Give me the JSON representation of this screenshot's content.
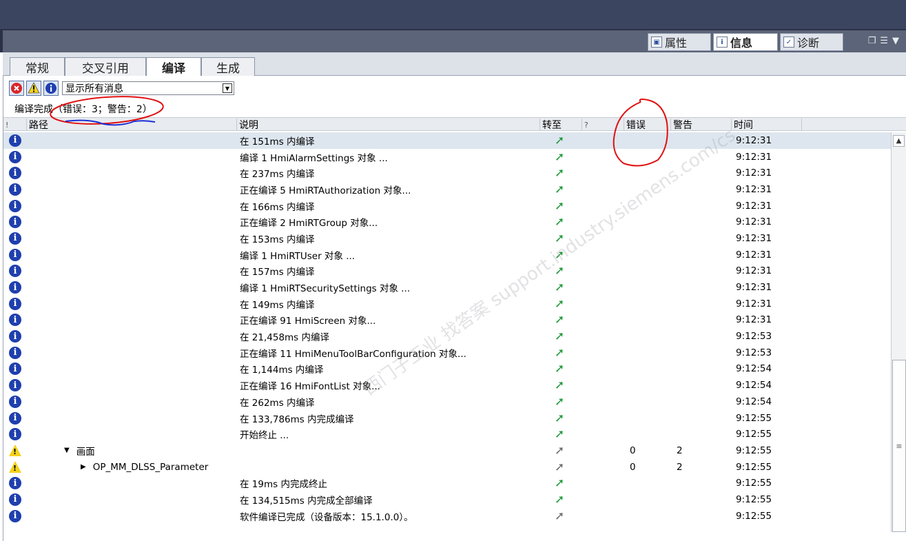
{
  "right_tabs": [
    {
      "label": "属性",
      "icon": "properties-icon"
    },
    {
      "label": "信息",
      "icon": "info-icon"
    },
    {
      "label": "诊断",
      "icon": "diagnostics-icon"
    }
  ],
  "left_tabs": [
    "常规",
    "交叉引用",
    "编译",
    "生成"
  ],
  "filter": {
    "selected": "显示所有消息"
  },
  "status_text": "编译完成（错误：3；警告：2）",
  "headers": {
    "bang": "!",
    "path": "路径",
    "desc": "说明",
    "goto": "转至",
    "q": "?",
    "errors": "错误",
    "warnings": "警告",
    "time": "时间"
  },
  "rows": [
    {
      "type": "info",
      "path": "",
      "desc": "在 151ms 内编译",
      "errors": "",
      "warnings": "",
      "time": "9:12:31",
      "goto": "green"
    },
    {
      "type": "info",
      "path": "",
      "desc": "编译 1 HmiAlarmSettings 对象 ...",
      "errors": "",
      "warnings": "",
      "time": "9:12:31",
      "goto": "green"
    },
    {
      "type": "info",
      "path": "",
      "desc": "在 237ms 内编译",
      "errors": "",
      "warnings": "",
      "time": "9:12:31",
      "goto": "green"
    },
    {
      "type": "info",
      "path": "",
      "desc": "正在编译 5 HmiRTAuthorization 对象...",
      "errors": "",
      "warnings": "",
      "time": "9:12:31",
      "goto": "green"
    },
    {
      "type": "info",
      "path": "",
      "desc": "在 166ms 内编译",
      "errors": "",
      "warnings": "",
      "time": "9:12:31",
      "goto": "green"
    },
    {
      "type": "info",
      "path": "",
      "desc": "正在编译 2 HmiRTGroup 对象...",
      "errors": "",
      "warnings": "",
      "time": "9:12:31",
      "goto": "green"
    },
    {
      "type": "info",
      "path": "",
      "desc": "在 153ms 内编译",
      "errors": "",
      "warnings": "",
      "time": "9:12:31",
      "goto": "green"
    },
    {
      "type": "info",
      "path": "",
      "desc": "编译 1 HmiRTUser 对象 ...",
      "errors": "",
      "warnings": "",
      "time": "9:12:31",
      "goto": "green"
    },
    {
      "type": "info",
      "path": "",
      "desc": "在 157ms 内编译",
      "errors": "",
      "warnings": "",
      "time": "9:12:31",
      "goto": "green"
    },
    {
      "type": "info",
      "path": "",
      "desc": "编译 1 HmiRTSecuritySettings 对象 ...",
      "errors": "",
      "warnings": "",
      "time": "9:12:31",
      "goto": "green"
    },
    {
      "type": "info",
      "path": "",
      "desc": "在 149ms 内编译",
      "errors": "",
      "warnings": "",
      "time": "9:12:31",
      "goto": "green"
    },
    {
      "type": "info",
      "path": "",
      "desc": "正在编译 91 HmiScreen 对象...",
      "errors": "",
      "warnings": "",
      "time": "9:12:31",
      "goto": "green"
    },
    {
      "type": "info",
      "path": "",
      "desc": "在 21,458ms 内编译",
      "errors": "",
      "warnings": "",
      "time": "9:12:53",
      "goto": "green"
    },
    {
      "type": "info",
      "path": "",
      "desc": "正在编译 11 HmiMenuToolBarConfiguration 对象...",
      "errors": "",
      "warnings": "",
      "time": "9:12:53",
      "goto": "green"
    },
    {
      "type": "info",
      "path": "",
      "desc": "在 1,144ms 内编译",
      "errors": "",
      "warnings": "",
      "time": "9:12:54",
      "goto": "green"
    },
    {
      "type": "info",
      "path": "",
      "desc": "正在编译 16 HmiFontList 对象...",
      "errors": "",
      "warnings": "",
      "time": "9:12:54",
      "goto": "green"
    },
    {
      "type": "info",
      "path": "",
      "desc": "在 262ms 内编译",
      "errors": "",
      "warnings": "",
      "time": "9:12:54",
      "goto": "green"
    },
    {
      "type": "info",
      "path": "",
      "desc": "在 133,786ms 内完成编译",
      "errors": "",
      "warnings": "",
      "time": "9:12:55",
      "goto": "green"
    },
    {
      "type": "info",
      "path": "",
      "desc": "开始终止 ...",
      "errors": "",
      "warnings": "",
      "time": "9:12:55",
      "goto": "green"
    },
    {
      "type": "warn",
      "path": "画面",
      "expander": "▼",
      "indent": 1,
      "desc": "",
      "errors": "0",
      "warnings": "2",
      "time": "9:12:55",
      "goto": "gray"
    },
    {
      "type": "warn",
      "path": "OP_MM_DLSS_Parameter",
      "expander": "▶",
      "indent": 2,
      "desc": "",
      "errors": "0",
      "warnings": "2",
      "time": "9:12:55",
      "goto": "gray"
    },
    {
      "type": "info",
      "path": "",
      "desc": "在 19ms 内完成终止",
      "errors": "",
      "warnings": "",
      "time": "9:12:55",
      "goto": "green"
    },
    {
      "type": "info",
      "path": "",
      "desc": "在 134,515ms 内完成全部编译",
      "errors": "",
      "warnings": "",
      "time": "9:12:55",
      "goto": "green"
    },
    {
      "type": "info",
      "path": "",
      "desc": "软件编译已完成（设备版本：15.1.0.0）。",
      "errors": "",
      "warnings": "",
      "time": "9:12:55",
      "goto": "gray"
    }
  ],
  "watermark": "西门子工业 找答案 support.industry.siemens.com/cs",
  "colors": {
    "goto_green": "#1f9a3a",
    "goto_gray": "#6d6d6d",
    "annotation_red": "#e01010",
    "annotation_blue": "#1b2fd6"
  }
}
